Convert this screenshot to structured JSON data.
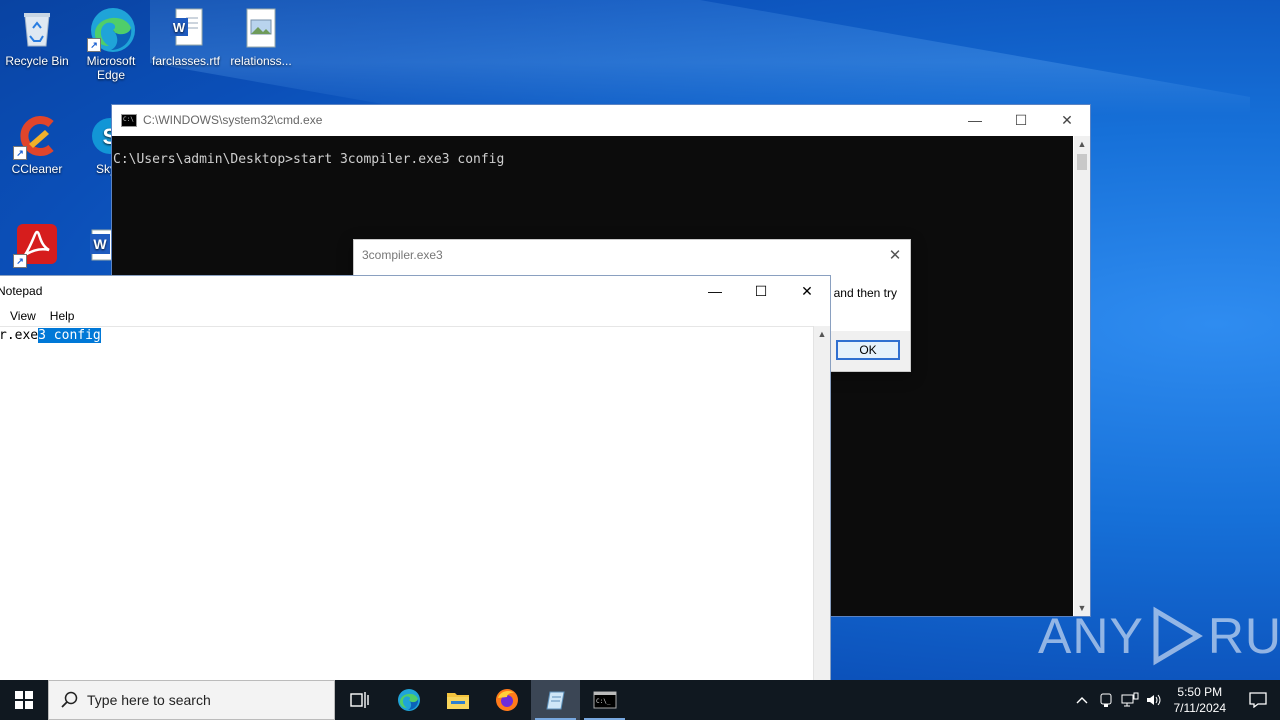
{
  "desktop": {
    "icons": [
      {
        "label": "Recycle Bin"
      },
      {
        "label": "Microsoft Edge"
      },
      {
        "label": "farclasses.rtf"
      },
      {
        "label": "relationss..."
      },
      {
        "label": "CCleaner"
      },
      {
        "label": "Sky"
      }
    ]
  },
  "cmd_window": {
    "title": "C:\\WINDOWS\\system32\\cmd.exe",
    "console_line": "C:\\Users\\admin\\Desktop>start 3compiler.exe3 config"
  },
  "dialog": {
    "title": "3compiler.exe3",
    "message_visible": "and then try",
    "ok_label": "OK"
  },
  "notepad": {
    "title": "Notepad",
    "menu": [
      "View",
      "Help"
    ],
    "text_before_selection": "r.exe",
    "selected_text": "3 config"
  },
  "taskbar": {
    "search_placeholder": "Type here to search",
    "time": "5:50 PM",
    "date": "7/11/2024"
  },
  "watermark": {
    "left": "ANY",
    "right": "RUN"
  }
}
